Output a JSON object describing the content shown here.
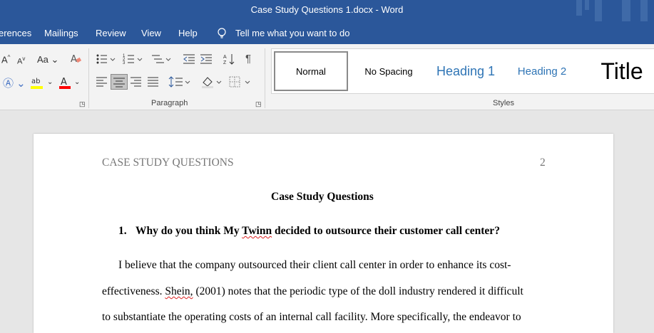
{
  "window": {
    "title": "Case Study Questions 1.docx  -  Word"
  },
  "menu": {
    "items": [
      "erences",
      "Mailings",
      "Review",
      "View",
      "Help"
    ],
    "tell_me": "Tell me what you want to do"
  },
  "ribbon": {
    "paragraph_label": "Paragraph",
    "styles_label": "Styles",
    "font_grow": "A",
    "font_shrink": "A",
    "change_case": "Aa",
    "styles": {
      "normal": "Normal",
      "no_spacing": "No Spacing",
      "heading1": "Heading 1",
      "heading2": "Heading 2",
      "title": "Title"
    },
    "colors": {
      "highlight": "#ffff00",
      "font_color": "#ff0000"
    }
  },
  "document": {
    "header_title": "CASE STUDY QUESTIONS",
    "page_number": "2",
    "heading": "Case Study Questions",
    "question_number": "1.",
    "question_pre": "Why do you think My ",
    "question_misspelled": "Twinn",
    "question_post": " decided to outsource their customer call center?",
    "line1": "I believe that the company outsourced their client call center in order to enhance its cost-",
    "line2_pre": "effectiveness. ",
    "line2_misspelled": "Shein,",
    "line2_post": " (2001) notes that the periodic type of the doll industry rendered it difficult",
    "line3": "to substantiate the operating costs of an internal call facility. More specifically, the endeavor to"
  }
}
